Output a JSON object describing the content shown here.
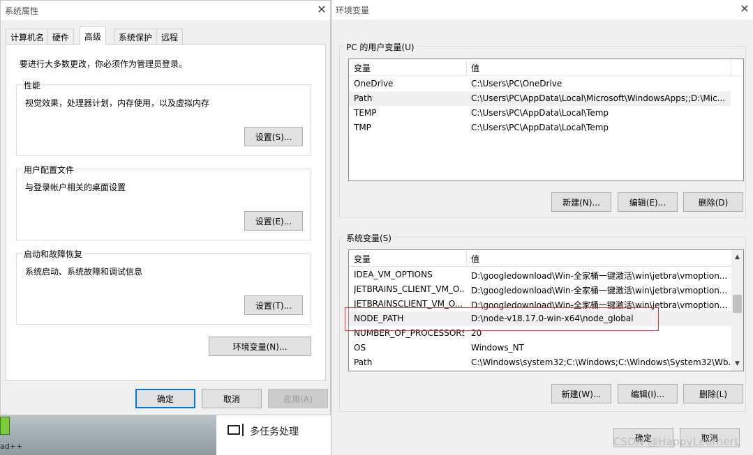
{
  "desktop": {
    "taskbar_label": "ad++",
    "multitask_label": "多任务处理"
  },
  "sys_props": {
    "title": "系统属性",
    "close_glyph": "✕",
    "tabs": [
      "计算机名",
      "硬件",
      "高级",
      "系统保护",
      "远程"
    ],
    "active_tab": "高级",
    "admin_note": "要进行大多数更改，你必须作为管理员登录。",
    "groups": [
      {
        "title": "性能",
        "desc": "视觉效果，处理器计划，内存使用，以及虚拟内存",
        "button": "设置(S)..."
      },
      {
        "title": "用户配置文件",
        "desc": "与登录帐户相关的桌面设置",
        "button": "设置(E)..."
      },
      {
        "title": "启动和故障恢复",
        "desc": "系统启动、系统故障和调试信息",
        "button": "设置(T)..."
      }
    ],
    "env_button": "环境变量(N)...",
    "ok": "确定",
    "cancel": "取消",
    "apply": "应用(A)"
  },
  "env_vars": {
    "title": "环境变量",
    "close_glyph": "✕",
    "user_section": {
      "title": "PC 的用户变量(U)",
      "col_var": "变量",
      "col_val": "值",
      "rows": [
        {
          "name": "OneDrive",
          "value": "C:\\Users\\PC\\OneDrive"
        },
        {
          "name": "Path",
          "value": "C:\\Users\\PC\\AppData\\Local\\Microsoft\\WindowsApps;;D:\\Mic..."
        },
        {
          "name": "TEMP",
          "value": "C:\\Users\\PC\\AppData\\Local\\Temp"
        },
        {
          "name": "TMP",
          "value": "C:\\Users\\PC\\AppData\\Local\\Temp"
        }
      ],
      "selected_row": "Path",
      "new": "新建(N)...",
      "edit": "编辑(E)...",
      "delete": "删除(D)"
    },
    "system_section": {
      "title": "系统变量(S)",
      "col_var": "变量",
      "col_val": "值",
      "rows": [
        {
          "name": "IDEA_VM_OPTIONS",
          "value": "D:\\googledownload\\Win-全家桶一键激活\\win\\jetbra\\vmoption..."
        },
        {
          "name": "JETBRAINS_CLIENT_VM_O...",
          "value": "D:\\googledownload\\Win-全家桶一键激活\\win\\jetbra\\vmoption..."
        },
        {
          "name": "JETBRAINSCLIENT_VM_O...",
          "value": "D:\\googledownload\\Win-全家桶一键激活\\win\\jetbra\\vmoption..."
        },
        {
          "name": "NODE_PATH",
          "value": "D:\\node-v18.17.0-win-x64\\node_global"
        },
        {
          "name": "NUMBER_OF_PROCESSORS",
          "value": "20"
        },
        {
          "name": "OS",
          "value": "Windows_NT"
        },
        {
          "name": "Path",
          "value": "C:\\Windows\\system32;C:\\Windows;C:\\Windows\\System32\\Wb..."
        }
      ],
      "highlighted_row": "NODE_PATH",
      "new": "新建(W)...",
      "edit": "编辑(I)...",
      "delete": "删除(L)"
    },
    "ok": "确定",
    "cancel": "取消"
  },
  "watermark": "CSDN @HappyLearnerL",
  "colors": {
    "highlight_box": "#e53935",
    "focus_border": "#0078d7",
    "selected_row": "#f0f0f0"
  }
}
